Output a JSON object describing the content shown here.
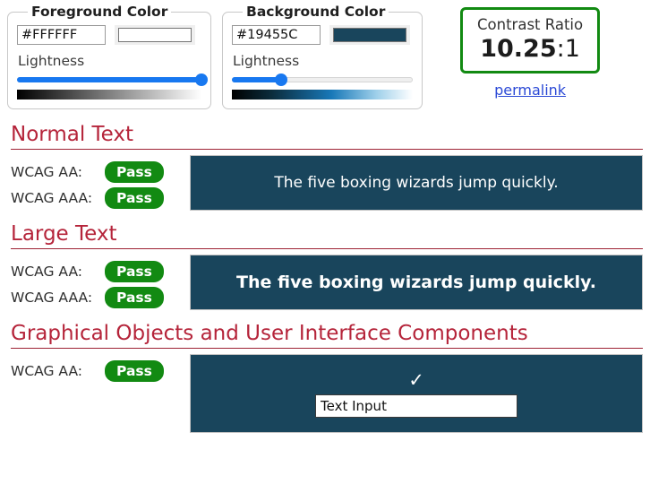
{
  "foreground": {
    "legend": "Foreground Color",
    "hex_value": "#FFFFFF",
    "hex_placeholder": "#FFFFFF",
    "swatch_color": "#FFFFFF",
    "lightness_label": "Lightness",
    "lightness_percent": 100
  },
  "background": {
    "legend": "Background Color",
    "hex_value": "#19455C",
    "hex_placeholder": "#19455C",
    "swatch_color": "#19455C",
    "lightness_label": "Lightness",
    "lightness_percent": 27
  },
  "contrast": {
    "title": "Contrast Ratio",
    "value": "10.25",
    "suffix": ":1",
    "full_text": "10.25:1",
    "border_color": "#128a12",
    "permalink_label": "permalink"
  },
  "sections": [
    {
      "title": "Normal Text",
      "criteria": [
        {
          "label": "WCAG AA:",
          "result": "Pass"
        },
        {
          "label": "WCAG AAA:",
          "result": "Pass"
        }
      ],
      "sample_text": "The five boxing wizards jump quickly."
    },
    {
      "title": "Large Text",
      "criteria": [
        {
          "label": "WCAG AA:",
          "result": "Pass"
        },
        {
          "label": "WCAG AAA:",
          "result": "Pass"
        }
      ],
      "sample_text": "The five boxing wizards jump quickly."
    },
    {
      "title": "Graphical Objects and User Interface Components",
      "criteria": [
        {
          "label": "WCAG AA:",
          "result": "Pass"
        }
      ],
      "check_glyph": "✓",
      "text_input_value": "Text Input",
      "text_input_placeholder": "Text Input"
    }
  ],
  "colors": {
    "heading": "#b5243a",
    "badge_pass": "#128a12",
    "preview_bg": "#19455C",
    "preview_fg": "#FFFFFF",
    "slider_accent": "#1878f0",
    "link": "#2b49d6"
  }
}
